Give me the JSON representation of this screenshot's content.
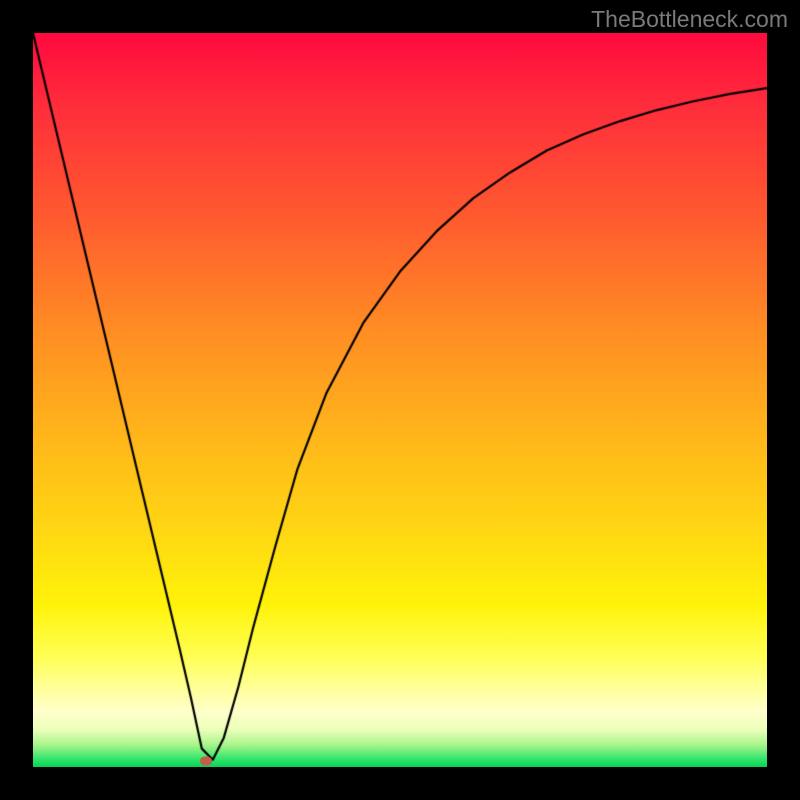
{
  "attribution": "TheBottleneck.com",
  "marker": {
    "x_frac": 0.236,
    "y_frac": 0.992
  },
  "chart_data": {
    "type": "line",
    "title": "",
    "xlabel": "",
    "ylabel": "",
    "xlim": [
      0,
      1
    ],
    "ylim": [
      0,
      1
    ],
    "series": [
      {
        "name": "bottleneck-curve",
        "x": [
          0.0,
          0.05,
          0.1,
          0.15,
          0.2,
          0.215,
          0.23,
          0.245,
          0.26,
          0.28,
          0.3,
          0.33,
          0.36,
          0.4,
          0.45,
          0.5,
          0.55,
          0.6,
          0.65,
          0.7,
          0.75,
          0.8,
          0.85,
          0.9,
          0.95,
          1.0
        ],
        "y": [
          1.0,
          0.79,
          0.58,
          0.37,
          0.16,
          0.095,
          0.025,
          0.01,
          0.04,
          0.11,
          0.19,
          0.3,
          0.405,
          0.51,
          0.605,
          0.675,
          0.73,
          0.775,
          0.81,
          0.84,
          0.862,
          0.88,
          0.895,
          0.907,
          0.917,
          0.925
        ]
      }
    ],
    "annotations": [
      {
        "type": "marker",
        "x": 0.236,
        "y": 0.008,
        "color": "#c06048"
      }
    ],
    "background_gradient": {
      "direction": "vertical",
      "stops": [
        {
          "pos": 0.0,
          "color": "#ff0a3e"
        },
        {
          "pos": 0.5,
          "color": "#ffb61a"
        },
        {
          "pos": 0.8,
          "color": "#fff30a"
        },
        {
          "pos": 0.95,
          "color": "#e9ffb8"
        },
        {
          "pos": 1.0,
          "color": "#08d154"
        }
      ]
    }
  }
}
